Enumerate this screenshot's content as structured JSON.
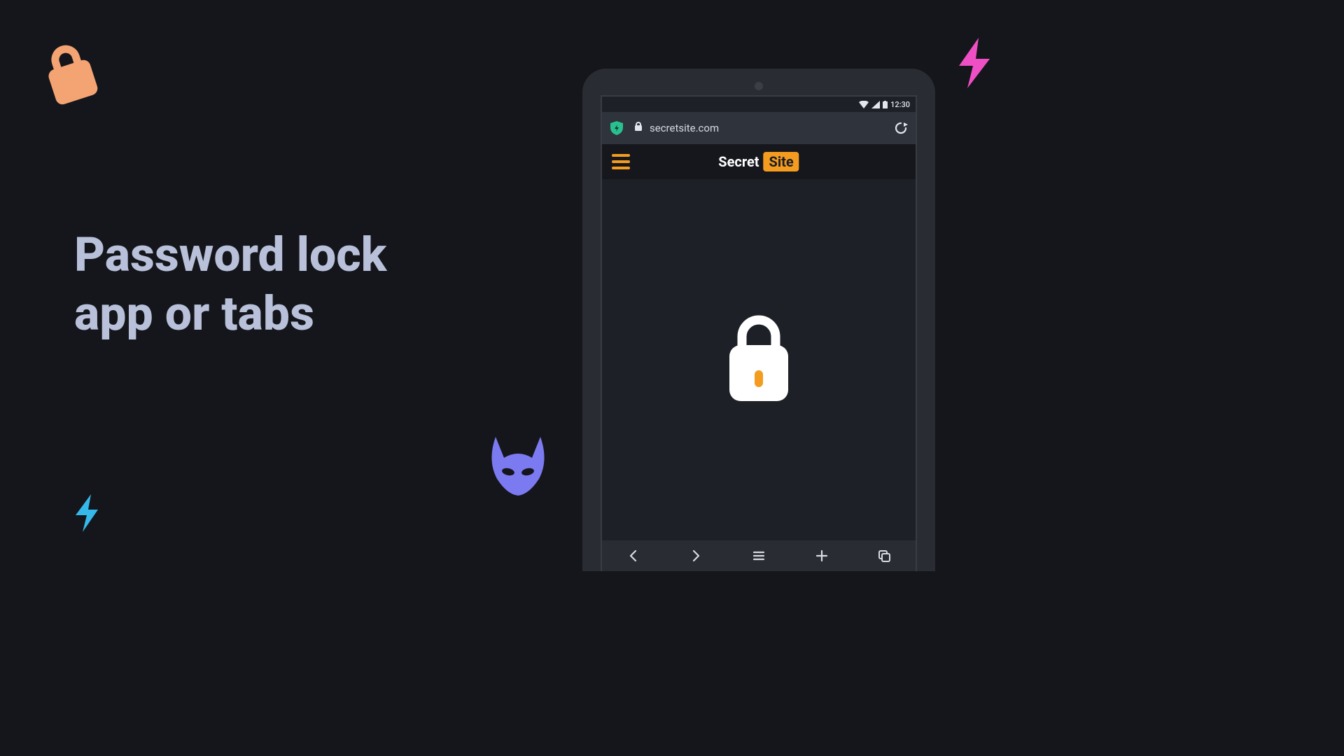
{
  "headline": {
    "line1": "Password lock",
    "line2": "app or tabs"
  },
  "icons": {
    "deco_lock": "lock-icon",
    "deco_bolt_pink": "bolt-icon",
    "deco_bolt_cyan": "bolt-icon",
    "deco_mask": "mask-icon"
  },
  "colors": {
    "accent_orange": "#f39c1f",
    "accent_pink": "#ef4fc4",
    "accent_cyan": "#35b9ea",
    "accent_purple": "#7b7af0",
    "accent_teal": "#29c08f",
    "text_headline": "#b8c1d9"
  },
  "tablet": {
    "status": {
      "time": "12:30",
      "wifi": "wifi-icon",
      "signal": "cellular-icon",
      "battery": "battery-icon"
    },
    "browser": {
      "shield": "shield-icon",
      "lock": "lock-icon",
      "url": "secretsite.com",
      "reload": "reload-icon"
    },
    "site": {
      "hamburger": "menu-icon",
      "title_primary": "Secret",
      "title_badge": "Site",
      "content_lock": "lock-icon"
    },
    "toolbar": {
      "back": "chevron-left-icon",
      "forward": "chevron-right-icon",
      "menu": "menu-icon",
      "add": "plus-icon",
      "tabs": "tabs-icon"
    }
  }
}
